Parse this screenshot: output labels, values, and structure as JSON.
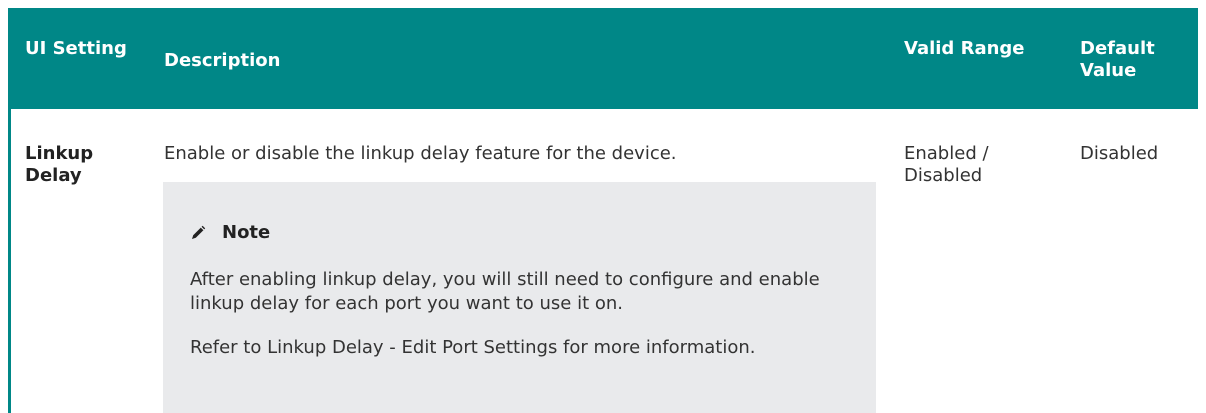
{
  "table": {
    "headers": {
      "ui_setting": "UI Setting",
      "description": "Description",
      "valid_range": "Valid Range",
      "default_value": "Default Value"
    },
    "rows": [
      {
        "ui_setting": "Linkup Delay",
        "description": "Enable or disable the linkup delay feature for the device.",
        "valid_range": "Enabled / Disabled",
        "default_value": "Disabled",
        "note": {
          "icon": "pencil-icon",
          "title": "Note",
          "paragraphs": [
            "After enabling linkup delay, you will still need to configure and enable linkup delay for each port you want to use it on.",
            "Refer to Linkup Delay - Edit Port Settings for more information."
          ]
        }
      }
    ]
  },
  "colors": {
    "header_bg": "#008787",
    "header_text": "#ffffff",
    "note_bg": "#e9eaec",
    "text": "#333333"
  }
}
